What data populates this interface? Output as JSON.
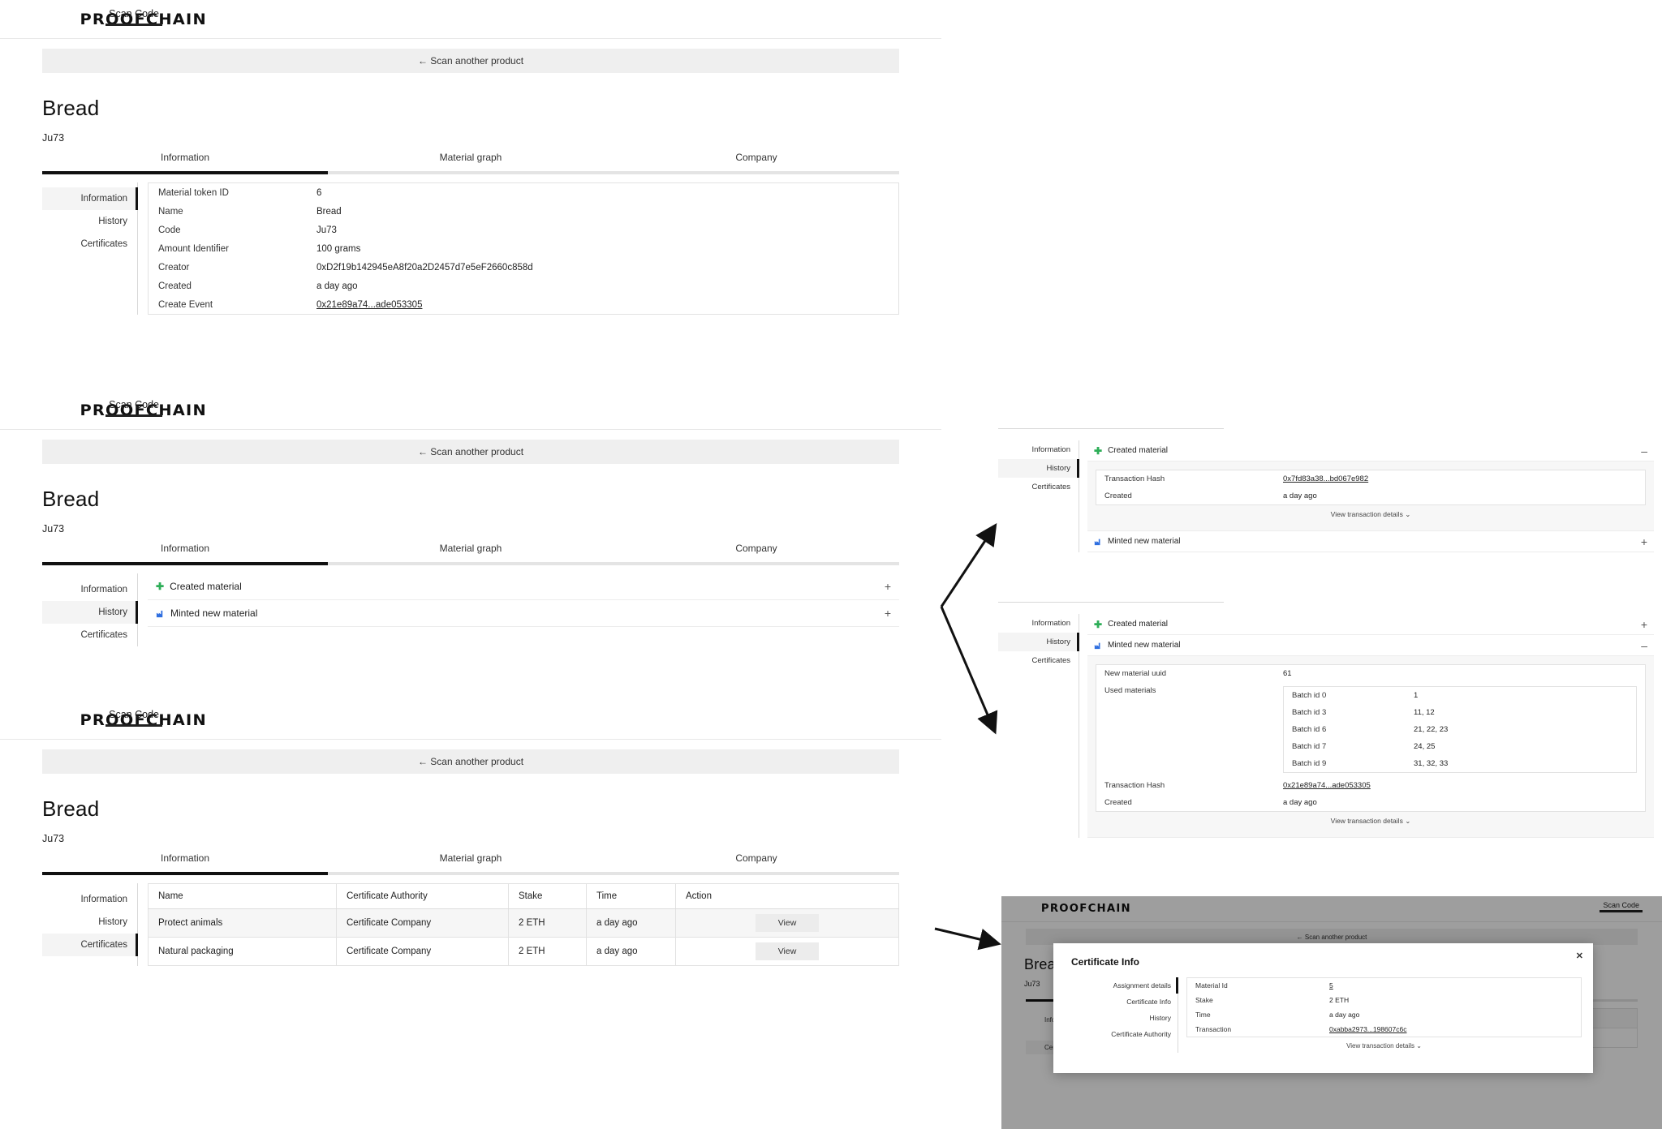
{
  "brand": {
    "logo": "PROOFCHAIN"
  },
  "nav": {
    "scan_code": "Scan Code"
  },
  "scan_bar": {
    "label": "← Scan another product"
  },
  "product": {
    "title": "Bread",
    "code": "Ju73"
  },
  "tabs": [
    {
      "label": "Information",
      "active": true
    },
    {
      "label": "Material graph",
      "active": false
    },
    {
      "label": "Company",
      "active": false
    }
  ],
  "sidenav": [
    {
      "label": "Information"
    },
    {
      "label": "History"
    },
    {
      "label": "Certificates"
    }
  ],
  "information": {
    "rows": [
      {
        "key": "Material token ID",
        "value": "6",
        "link": false
      },
      {
        "key": "Name",
        "value": "Bread",
        "link": false
      },
      {
        "key": "Code",
        "value": "Ju73",
        "link": false
      },
      {
        "key": "Amount Identifier",
        "value": "100 grams",
        "link": false
      },
      {
        "key": "Creator",
        "value": "0xD2f19b142945eA8f20a2D2457d7e5eF2660c858d",
        "link": false
      },
      {
        "key": "Created",
        "value": "a day ago",
        "link": false
      },
      {
        "key": "Create Event",
        "value": "0x21e89a74...ade053305",
        "link": true
      }
    ]
  },
  "history": {
    "created_material": {
      "label": "Created material",
      "icon": "plus-icon",
      "expand": "+",
      "collapse": "–"
    },
    "minted_material": {
      "label": "Minted new material",
      "icon": "factory-icon",
      "expand": "+",
      "collapse": "–"
    },
    "view_transaction_details": "View transaction details",
    "created_detail_rows": [
      {
        "key": "Transaction Hash",
        "value": "0x7fd83a38...bd067e982",
        "link": true
      },
      {
        "key": "Created",
        "value": "a day ago",
        "link": false
      }
    ],
    "minted_detail": {
      "new_material_uuid_key": "New material uuid",
      "new_material_uuid_value": "61",
      "used_materials_key": "Used materials",
      "used_materials": [
        {
          "key": "Batch id 0",
          "value": "1"
        },
        {
          "key": "Batch id 3",
          "value": "11, 12"
        },
        {
          "key": "Batch id 6",
          "value": "21, 22, 23"
        },
        {
          "key": "Batch id 7",
          "value": "24, 25"
        },
        {
          "key": "Batch id 9",
          "value": "31, 32, 33"
        }
      ],
      "transaction_hash_key": "Transaction Hash",
      "transaction_hash_value": "0x21e89a74...ade053305",
      "created_key": "Created",
      "created_value": "a day ago"
    }
  },
  "certificates": {
    "columns": [
      "Name",
      "Certificate Authority",
      "Stake",
      "Time",
      "Action"
    ],
    "rows": [
      {
        "name": "Protect animals",
        "authority": "Certificate Company",
        "stake": "2 ETH",
        "time": "a day ago",
        "action": "View"
      },
      {
        "name": "Natural packaging",
        "authority": "Certificate Company",
        "stake": "2 ETH",
        "time": "a day ago",
        "action": "View"
      }
    ]
  },
  "certificate_modal": {
    "title": "Certificate Info",
    "close": "✕",
    "sidenav": [
      {
        "label": "Assignment details"
      },
      {
        "label": "Certificate Info"
      },
      {
        "label": "History"
      },
      {
        "label": "Certificate Authority"
      }
    ],
    "rows": [
      {
        "key": "Material Id",
        "value": "5",
        "link": true
      },
      {
        "key": "Stake",
        "value": "2 ETH",
        "link": false
      },
      {
        "key": "Time",
        "value": "a day ago",
        "link": false
      },
      {
        "key": "Transaction",
        "value": "0xabba2973...198607c6c",
        "link": true
      }
    ],
    "view_transaction_details": "View transaction details"
  },
  "colors": {
    "accent_green": "#2eae58",
    "accent_blue": "#2f6fe0",
    "underline_active": "#111111",
    "underline_rest": "#e4e4e4",
    "panel_bg": "#efefef"
  }
}
